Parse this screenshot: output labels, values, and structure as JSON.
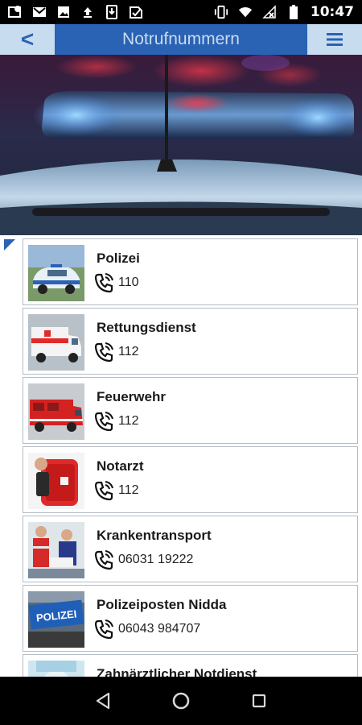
{
  "status_bar": {
    "time": "10:47",
    "left_icons": [
      "location-icon",
      "gmail-icon",
      "image-icon",
      "upload-icon",
      "download-icon",
      "check-icon"
    ],
    "right_icons": [
      "vibrate-icon",
      "wifi-icon",
      "no-signal-icon",
      "battery-icon"
    ]
  },
  "header": {
    "back_label": "<",
    "title": "Notrufnummern",
    "menu_icon": "hamburger-icon"
  },
  "list": {
    "items": [
      {
        "name": "Polizei",
        "number": "110",
        "image": "police-car"
      },
      {
        "name": "Rettungsdienst",
        "number": "112",
        "image": "ambulance"
      },
      {
        "name": "Feuerwehr",
        "number": "112",
        "image": "fire-truck"
      },
      {
        "name": "Notarzt",
        "number": "112",
        "image": "medic-bag"
      },
      {
        "name": "Krankentransport",
        "number": "06031 19222",
        "image": "paramedics"
      },
      {
        "name": "Polizeiposten Nidda",
        "number": "06043 984707",
        "image": "polizei-sign",
        "sign_text": "POLIZEI"
      },
      {
        "name": "Zahnärztlicher Notdienst",
        "number": "",
        "image": "dentist"
      }
    ]
  },
  "colors": {
    "accent": "#2a62b4",
    "header_button_bg": "#c8dcf0",
    "item_border": "#b4bcc6"
  },
  "nav_bar": {
    "icons": [
      "back-triangle-icon",
      "home-circle-icon",
      "recents-square-icon"
    ]
  }
}
